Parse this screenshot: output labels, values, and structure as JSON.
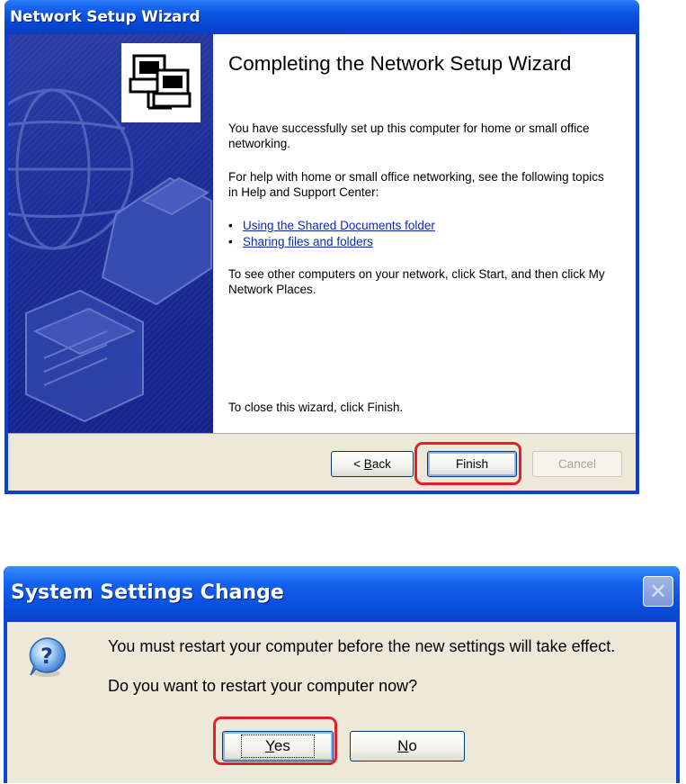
{
  "wizard": {
    "title": "Network Setup Wizard",
    "heading": "Completing the Network Setup Wizard",
    "para1": "You have successfully set up this computer for home or small office networking.",
    "para2": "For help with home or small office networking, see the following topics in Help and Support Center:",
    "links": [
      "Using the Shared Documents folder",
      "Sharing files and folders"
    ],
    "para3": "To see other computers on your network, click Start, and then click My Network Places.",
    "close_text": "To close this wizard, click Finish.",
    "buttons": {
      "back_prefix": "< ",
      "back_mnemonic": "B",
      "back_rest": "ack",
      "finish": "Finish",
      "cancel": "Cancel"
    },
    "bullet": "•"
  },
  "system_dialog": {
    "title": "System Settings Change",
    "message1": "You must restart your computer before the new settings will take effect.",
    "message2": "Do you want to restart your computer now?",
    "yes_mnemonic": "Y",
    "yes_rest": "es",
    "no_mnemonic": "N",
    "no_rest": "o",
    "close_glyph": "✕",
    "icon_glyph": "?"
  },
  "colors": {
    "highlight": "#e0202e",
    "titlebar_blue": "#0a4fde",
    "link_blue": "#0b2bb5",
    "dialog_bg": "#ece9d8"
  }
}
